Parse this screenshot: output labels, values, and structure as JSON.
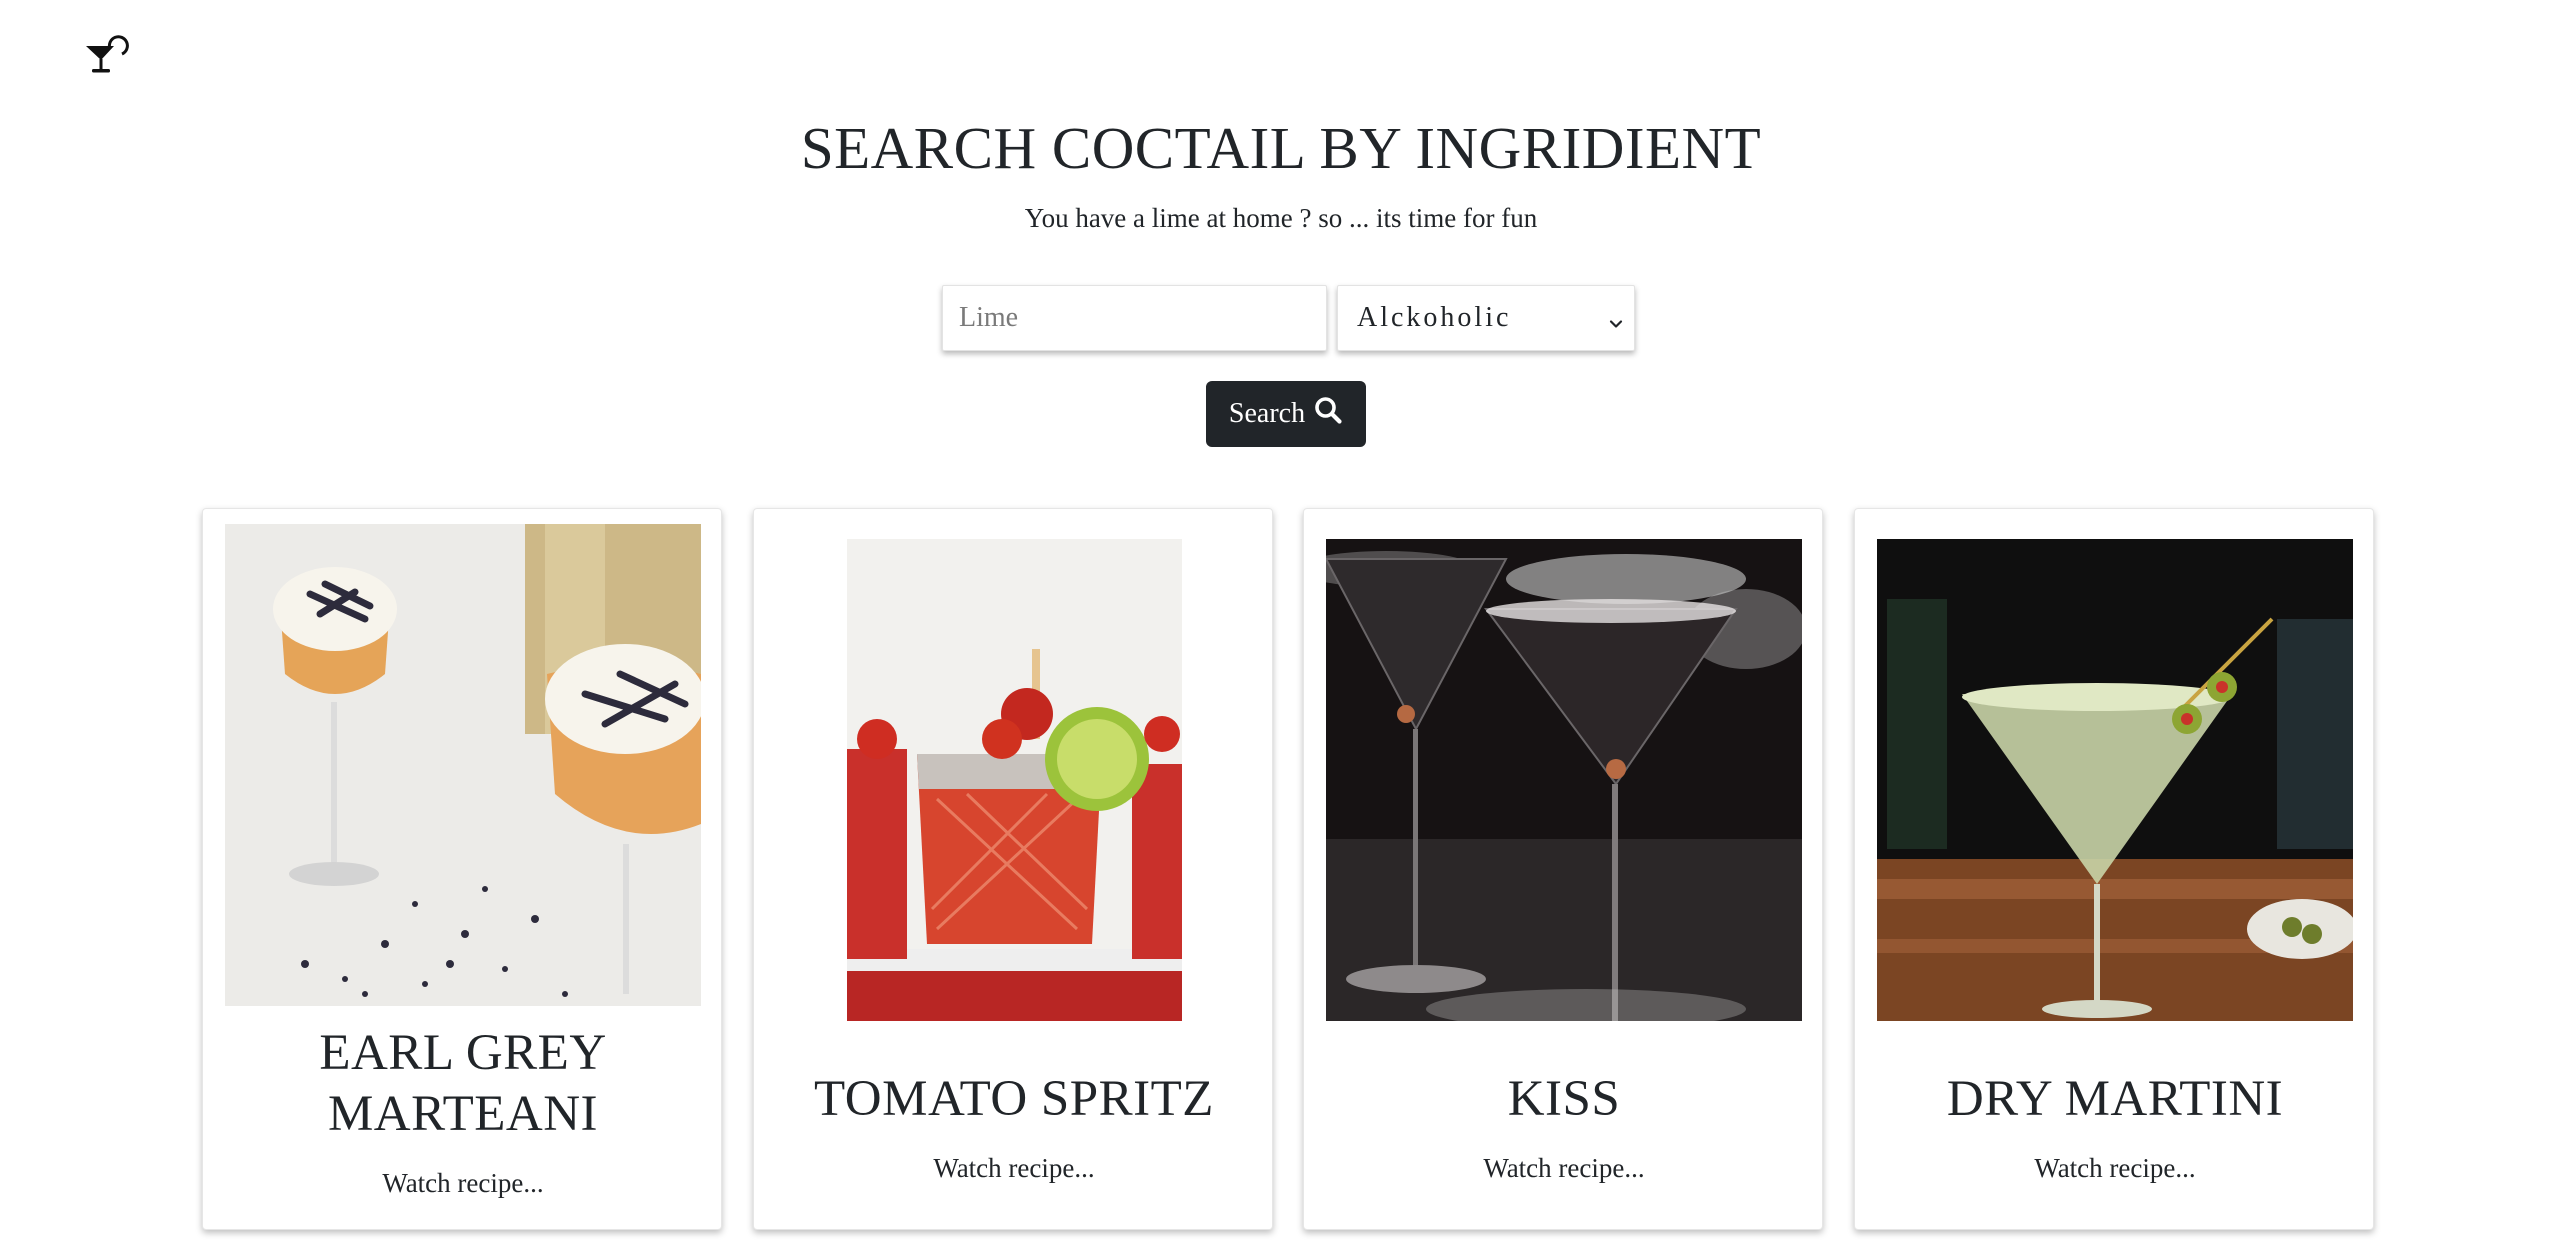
{
  "header": {
    "logo_icon": "cocktail-glass-icon"
  },
  "hero": {
    "title": "SEARCH COCTAIL BY INGRIDIENT",
    "subtitle": "You have a lime at home ? so ... its time for fun"
  },
  "search": {
    "input_placeholder": "Lime",
    "input_value": "",
    "select_value": "Alckoholic",
    "select_icon": "chevron-down-icon",
    "button_label": "Search",
    "button_icon": "search-icon"
  },
  "cards": [
    {
      "title": "EARL GREY MARTEANI",
      "link": "Watch recipe...",
      "image": "earl-grey-marteani-photo"
    },
    {
      "title": "TOMATO SPRITZ",
      "link": "Watch recipe...",
      "image": "tomato-spritz-photo"
    },
    {
      "title": "KISS",
      "link": "Watch recipe...",
      "image": "kiss-photo"
    },
    {
      "title": "DRY MARTINI",
      "link": "Watch recipe...",
      "image": "dry-martini-photo"
    }
  ],
  "colors": {
    "text": "#212529",
    "button_bg": "#212529",
    "button_text": "#ffffff",
    "background": "#ffffff"
  }
}
